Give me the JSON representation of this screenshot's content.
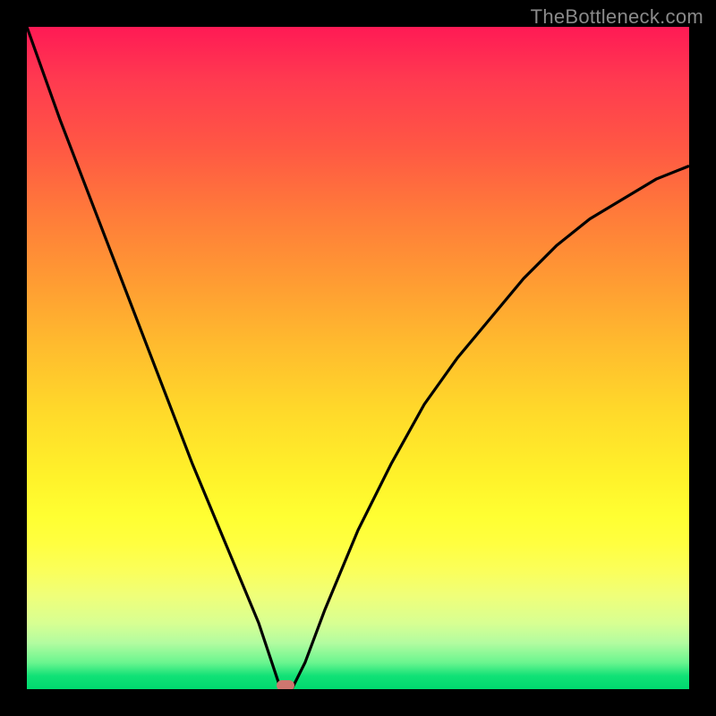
{
  "watermark": "TheBottleneck.com",
  "chart_data": {
    "type": "line",
    "title": "",
    "xlabel": "",
    "ylabel": "",
    "xlim": [
      0,
      100
    ],
    "ylim": [
      0,
      100
    ],
    "grid": false,
    "legend": false,
    "series": [
      {
        "name": "curve",
        "x": [
          0,
          5,
          10,
          15,
          20,
          25,
          30,
          35,
          37,
          38,
          39,
          40,
          42,
          45,
          50,
          55,
          60,
          65,
          70,
          75,
          80,
          85,
          90,
          95,
          100
        ],
        "y": [
          100,
          86,
          73,
          60,
          47,
          34,
          22,
          10,
          4,
          1,
          0,
          0,
          4,
          12,
          24,
          34,
          43,
          50,
          56,
          62,
          67,
          71,
          74,
          77,
          79
        ]
      }
    ],
    "marker": {
      "x": 39,
      "y": 0,
      "color": "#cf766f"
    },
    "background_gradient": {
      "orientation": "vertical",
      "stops": [
        {
          "pos": 0,
          "color": "#ff1a55"
        },
        {
          "pos": 50,
          "color": "#ffcc2c"
        },
        {
          "pos": 78,
          "color": "#ffff40"
        },
        {
          "pos": 100,
          "color": "#00d96f"
        }
      ]
    }
  }
}
